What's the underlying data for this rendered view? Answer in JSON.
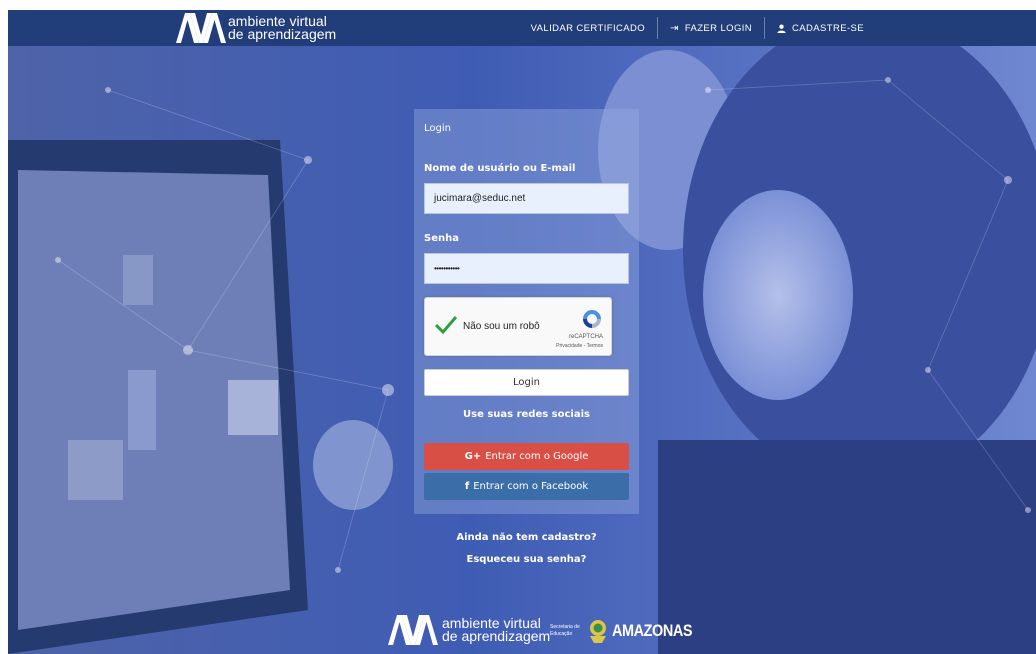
{
  "brand": {
    "line1": "ambiente virtual",
    "line2": "de aprendizagem"
  },
  "nav": {
    "validate": "VALIDAR CERTIFICADO",
    "login": "FAZER LOGIN",
    "signup": "CADASTRE-SE"
  },
  "form": {
    "title": "Login",
    "username_label": "Nome de usuário ou E-mail",
    "username_value": "jucimara@seduc.net",
    "password_label": "Senha",
    "password_value": "•••••••••••",
    "login_button": "Login",
    "social_title": "Use suas redes sociais",
    "google_icon": "G+",
    "google_button": "Entrar com o Google",
    "facebook_icon": "f",
    "facebook_button": "Entrar com o Facebook"
  },
  "captcha": {
    "label": "Não sou um robô",
    "brand": "reCAPTCHA",
    "links": "Privacidade - Termos",
    "checked": true
  },
  "links": {
    "register": "Ainda não tem cadastro?",
    "forgot": "Esqueceu sua senha?"
  },
  "footer": {
    "brand_line1": "ambiente virtual",
    "brand_line2": "de aprendizagem",
    "secretaria": "Secretaria de Educação",
    "state": "AMAZONAS"
  },
  "colors": {
    "navbar": "#213d7a",
    "google": "#d84f45",
    "facebook": "#3b6ea9",
    "check": "#2e9e3f"
  },
  "icons": {
    "login": "sign-in-icon",
    "signup": "user-icon",
    "captcha_check": "checkmark-icon",
    "captcha_logo": "recaptcha-icon"
  }
}
